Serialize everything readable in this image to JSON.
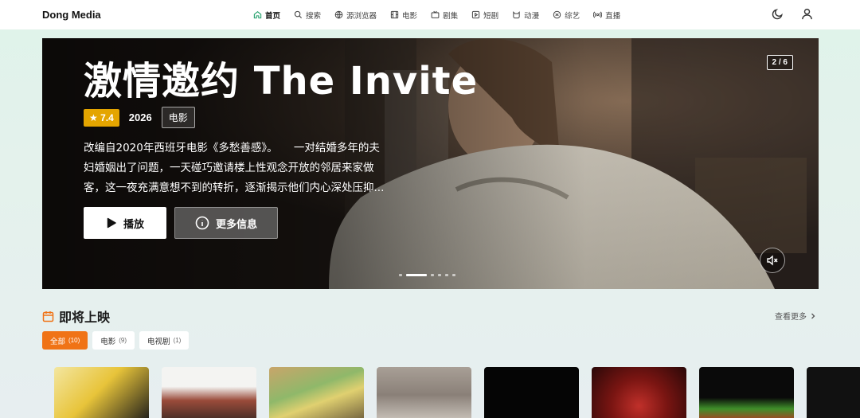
{
  "brand": "Dong Media",
  "nav": [
    {
      "label": "首页",
      "icon": "home-icon",
      "active": true
    },
    {
      "label": "搜索",
      "icon": "search-icon"
    },
    {
      "label": "源浏览器",
      "icon": "globe-icon"
    },
    {
      "label": "电影",
      "icon": "film-icon"
    },
    {
      "label": "剧集",
      "icon": "tv-icon"
    },
    {
      "label": "短剧",
      "icon": "play-square-icon"
    },
    {
      "label": "动漫",
      "icon": "cat-icon"
    },
    {
      "label": "综艺",
      "icon": "sparkle-icon"
    },
    {
      "label": "直播",
      "icon": "broadcast-icon"
    }
  ],
  "hero": {
    "title": "激情邀约 The Invite",
    "rating": "★ 7.4",
    "year": "2026",
    "type": "电影",
    "description": "改编自2020年西班牙电影《多愁善感》。　　一对结婚多年的夫妇婚姻出了问题，一天碰巧邀请楼上性观念开放的邻居来家做客，这一夜充满意想不到的转折，逐渐揭示他们内心深处压抑...",
    "play_label": "播放",
    "info_label": "更多信息",
    "counter": "2 / 6",
    "slide_count": 6,
    "active_slide": 2
  },
  "section": {
    "title": "即将上映",
    "see_more": "查看更多",
    "filters": [
      {
        "label": "全部",
        "count": "(10)",
        "active": true
      },
      {
        "label": "电影",
        "count": "(9)"
      },
      {
        "label": "电视剧",
        "count": "(1)"
      }
    ]
  },
  "colors": {
    "accent_green": "#22a06b",
    "accent_orange": "#f07316",
    "rating_gold": "#e4a500"
  }
}
